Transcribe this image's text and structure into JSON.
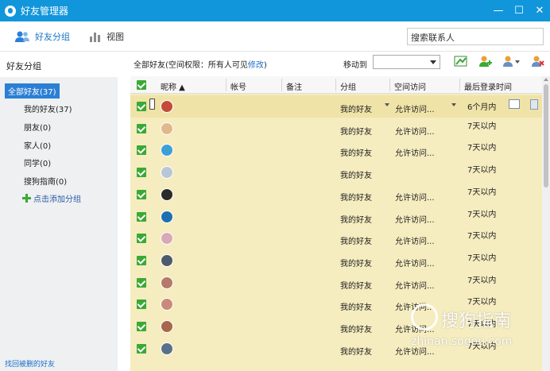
{
  "window": {
    "title": "好友管理器",
    "minimize": "—",
    "maximize": "☐",
    "close": "✕"
  },
  "toolbar": {
    "friends_group": "好友分组",
    "view": "视图",
    "search_placeholder": "搜索联系人"
  },
  "sidebar": {
    "heading": "好友分组",
    "all_friends": "全部好友(37)",
    "groups": [
      "我的好友(37)",
      "朋友(0)",
      "家人(0)",
      "同学(0)",
      "搜狗指南(0)"
    ],
    "add_group": "点击添加分组",
    "recover": "找回被删的好友"
  },
  "main": {
    "summary_prefix": "全部好友(空间权限：所有人可见",
    "summary_link": "修改",
    "summary_suffix": ")",
    "move_to": "移动到"
  },
  "table": {
    "columns": [
      "昵称",
      "帐号",
      "备注",
      "分组",
      "空间访问",
      "最后登录时间"
    ],
    "rows": [
      {
        "group": "我的好友",
        "access": "允许访问...",
        "last_login": "6个月内",
        "avatar_color": "#c44a3a"
      },
      {
        "group": "我的好友",
        "access": "允许访问...",
        "last_login": "7天以内",
        "avatar_color": "#e0b98a"
      },
      {
        "group": "我的好友",
        "access": "允许访问...",
        "last_login": "7天以内",
        "avatar_color": "#3c9fd6"
      },
      {
        "group": "我的好友",
        "access": "",
        "last_login": "7天以内",
        "avatar_color": "#b9c6d6"
      },
      {
        "group": "我的好友",
        "access": "允许访问...",
        "last_login": "7天以内",
        "avatar_color": "#2a2a2a"
      },
      {
        "group": "我的好友",
        "access": "允许访问...",
        "last_login": "7天以内",
        "avatar_color": "#1f6fb0"
      },
      {
        "group": "我的好友",
        "access": "允许访问...",
        "last_login": "7天以内",
        "avatar_color": "#d8a9b6"
      },
      {
        "group": "我的好友",
        "access": "允许访问...",
        "last_login": "7天以内",
        "avatar_color": "#4c5b6b"
      },
      {
        "group": "我的好友",
        "access": "允许访问...",
        "last_login": "7天以内",
        "avatar_color": "#b57a6a"
      },
      {
        "group": "我的好友",
        "access": "允许访问...",
        "last_login": "7天以内",
        "avatar_color": "#c98a7a"
      },
      {
        "group": "我的好友",
        "access": "允许访问...",
        "last_login": "7天以内",
        "avatar_color": "#a8664a"
      },
      {
        "group": "我的好友",
        "access": "允许访问...",
        "last_login": "7天以内",
        "avatar_color": "#5a6f8a"
      }
    ]
  },
  "watermark": {
    "brand": "搜狗指南",
    "site": "zhinan.sogou.com"
  },
  "colors": {
    "titlebar": "#1296db",
    "check": "#3aa935",
    "row_bg": "#f5ecbf",
    "selected_group": "#2b7fd4"
  }
}
